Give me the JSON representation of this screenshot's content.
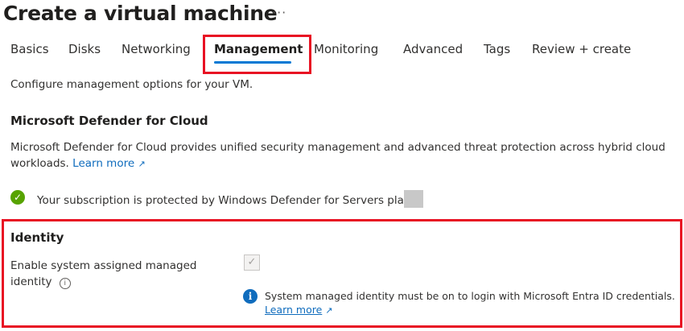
{
  "header": {
    "title": "Create a virtual machine",
    "more_label": "···"
  },
  "tabs": [
    {
      "label": "Basics"
    },
    {
      "label": "Disks"
    },
    {
      "label": "Networking"
    },
    {
      "label": "Management",
      "active": true
    },
    {
      "label": "Monitoring"
    },
    {
      "label": "Advanced"
    },
    {
      "label": "Tags"
    },
    {
      "label": "Review + create"
    }
  ],
  "description": "Configure management options for your VM.",
  "defender": {
    "heading": "Microsoft Defender for Cloud",
    "text_line1": "Microsoft Defender for Cloud provides unified security management and advanced threat protection across hybrid cloud",
    "text_line2": "workloads.",
    "learn_more": "Learn more",
    "status": "Your subscription is protected by Windows Defender for Servers plan"
  },
  "identity": {
    "heading": "Identity",
    "label_line1": "Enable system assigned managed",
    "label_line2": "identity",
    "checkbox_checked": true,
    "checkbox_disabled": true,
    "info_text": "System managed identity must be on to login with Microsoft Entra ID credentials.",
    "learn_more": "Learn more"
  },
  "colors": {
    "accent": "#0078d4",
    "highlight": "#e81123",
    "success": "#57a300",
    "info": "#0f6cbd"
  }
}
